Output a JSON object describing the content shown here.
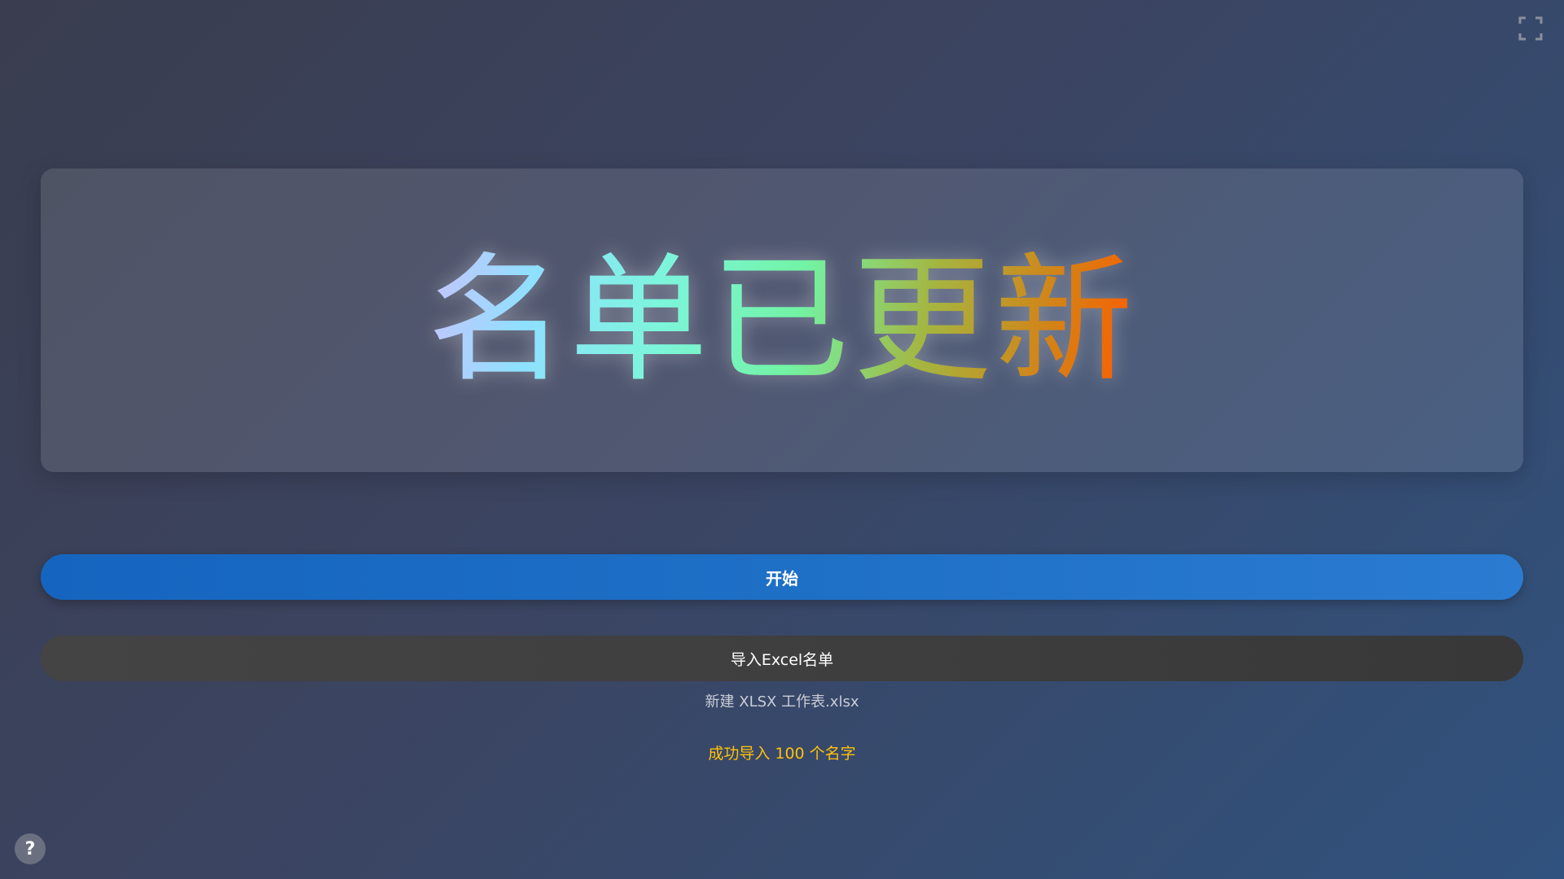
{
  "display": {
    "text": "名单已更新"
  },
  "buttons": {
    "start_label": "开始",
    "import_label": "导入Excel名单"
  },
  "import": {
    "file_name": "新建 XLSX 工作表.xlsx",
    "status": "成功导入 100 个名字"
  },
  "help": {
    "label": "?"
  },
  "icons": {
    "fullscreen": "fullscreen-icon",
    "help": "help-icon"
  },
  "colors": {
    "start_button": "#1e6fc6",
    "import_button": "#3f3f3f",
    "status_text": "#ffc107"
  }
}
